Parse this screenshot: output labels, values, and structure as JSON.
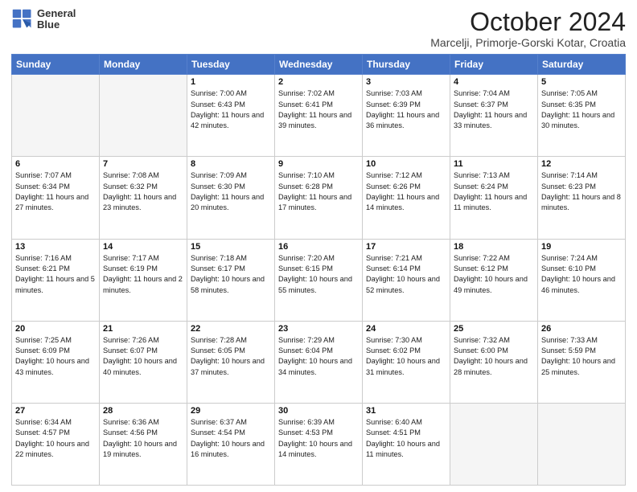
{
  "header": {
    "logo_line1": "General",
    "logo_line2": "Blue",
    "month": "October 2024",
    "location": "Marcelji, Primorje-Gorski Kotar, Croatia"
  },
  "weekdays": [
    "Sunday",
    "Monday",
    "Tuesday",
    "Wednesday",
    "Thursday",
    "Friday",
    "Saturday"
  ],
  "weeks": [
    [
      {
        "day": "",
        "info": ""
      },
      {
        "day": "",
        "info": ""
      },
      {
        "day": "1",
        "info": "Sunrise: 7:00 AM\nSunset: 6:43 PM\nDaylight: 11 hours and 42 minutes."
      },
      {
        "day": "2",
        "info": "Sunrise: 7:02 AM\nSunset: 6:41 PM\nDaylight: 11 hours and 39 minutes."
      },
      {
        "day": "3",
        "info": "Sunrise: 7:03 AM\nSunset: 6:39 PM\nDaylight: 11 hours and 36 minutes."
      },
      {
        "day": "4",
        "info": "Sunrise: 7:04 AM\nSunset: 6:37 PM\nDaylight: 11 hours and 33 minutes."
      },
      {
        "day": "5",
        "info": "Sunrise: 7:05 AM\nSunset: 6:35 PM\nDaylight: 11 hours and 30 minutes."
      }
    ],
    [
      {
        "day": "6",
        "info": "Sunrise: 7:07 AM\nSunset: 6:34 PM\nDaylight: 11 hours and 27 minutes."
      },
      {
        "day": "7",
        "info": "Sunrise: 7:08 AM\nSunset: 6:32 PM\nDaylight: 11 hours and 23 minutes."
      },
      {
        "day": "8",
        "info": "Sunrise: 7:09 AM\nSunset: 6:30 PM\nDaylight: 11 hours and 20 minutes."
      },
      {
        "day": "9",
        "info": "Sunrise: 7:10 AM\nSunset: 6:28 PM\nDaylight: 11 hours and 17 minutes."
      },
      {
        "day": "10",
        "info": "Sunrise: 7:12 AM\nSunset: 6:26 PM\nDaylight: 11 hours and 14 minutes."
      },
      {
        "day": "11",
        "info": "Sunrise: 7:13 AM\nSunset: 6:24 PM\nDaylight: 11 hours and 11 minutes."
      },
      {
        "day": "12",
        "info": "Sunrise: 7:14 AM\nSunset: 6:23 PM\nDaylight: 11 hours and 8 minutes."
      }
    ],
    [
      {
        "day": "13",
        "info": "Sunrise: 7:16 AM\nSunset: 6:21 PM\nDaylight: 11 hours and 5 minutes."
      },
      {
        "day": "14",
        "info": "Sunrise: 7:17 AM\nSunset: 6:19 PM\nDaylight: 11 hours and 2 minutes."
      },
      {
        "day": "15",
        "info": "Sunrise: 7:18 AM\nSunset: 6:17 PM\nDaylight: 10 hours and 58 minutes."
      },
      {
        "day": "16",
        "info": "Sunrise: 7:20 AM\nSunset: 6:15 PM\nDaylight: 10 hours and 55 minutes."
      },
      {
        "day": "17",
        "info": "Sunrise: 7:21 AM\nSunset: 6:14 PM\nDaylight: 10 hours and 52 minutes."
      },
      {
        "day": "18",
        "info": "Sunrise: 7:22 AM\nSunset: 6:12 PM\nDaylight: 10 hours and 49 minutes."
      },
      {
        "day": "19",
        "info": "Sunrise: 7:24 AM\nSunset: 6:10 PM\nDaylight: 10 hours and 46 minutes."
      }
    ],
    [
      {
        "day": "20",
        "info": "Sunrise: 7:25 AM\nSunset: 6:09 PM\nDaylight: 10 hours and 43 minutes."
      },
      {
        "day": "21",
        "info": "Sunrise: 7:26 AM\nSunset: 6:07 PM\nDaylight: 10 hours and 40 minutes."
      },
      {
        "day": "22",
        "info": "Sunrise: 7:28 AM\nSunset: 6:05 PM\nDaylight: 10 hours and 37 minutes."
      },
      {
        "day": "23",
        "info": "Sunrise: 7:29 AM\nSunset: 6:04 PM\nDaylight: 10 hours and 34 minutes."
      },
      {
        "day": "24",
        "info": "Sunrise: 7:30 AM\nSunset: 6:02 PM\nDaylight: 10 hours and 31 minutes."
      },
      {
        "day": "25",
        "info": "Sunrise: 7:32 AM\nSunset: 6:00 PM\nDaylight: 10 hours and 28 minutes."
      },
      {
        "day": "26",
        "info": "Sunrise: 7:33 AM\nSunset: 5:59 PM\nDaylight: 10 hours and 25 minutes."
      }
    ],
    [
      {
        "day": "27",
        "info": "Sunrise: 6:34 AM\nSunset: 4:57 PM\nDaylight: 10 hours and 22 minutes."
      },
      {
        "day": "28",
        "info": "Sunrise: 6:36 AM\nSunset: 4:56 PM\nDaylight: 10 hours and 19 minutes."
      },
      {
        "day": "29",
        "info": "Sunrise: 6:37 AM\nSunset: 4:54 PM\nDaylight: 10 hours and 16 minutes."
      },
      {
        "day": "30",
        "info": "Sunrise: 6:39 AM\nSunset: 4:53 PM\nDaylight: 10 hours and 14 minutes."
      },
      {
        "day": "31",
        "info": "Sunrise: 6:40 AM\nSunset: 4:51 PM\nDaylight: 10 hours and 11 minutes."
      },
      {
        "day": "",
        "info": ""
      },
      {
        "day": "",
        "info": ""
      }
    ]
  ]
}
